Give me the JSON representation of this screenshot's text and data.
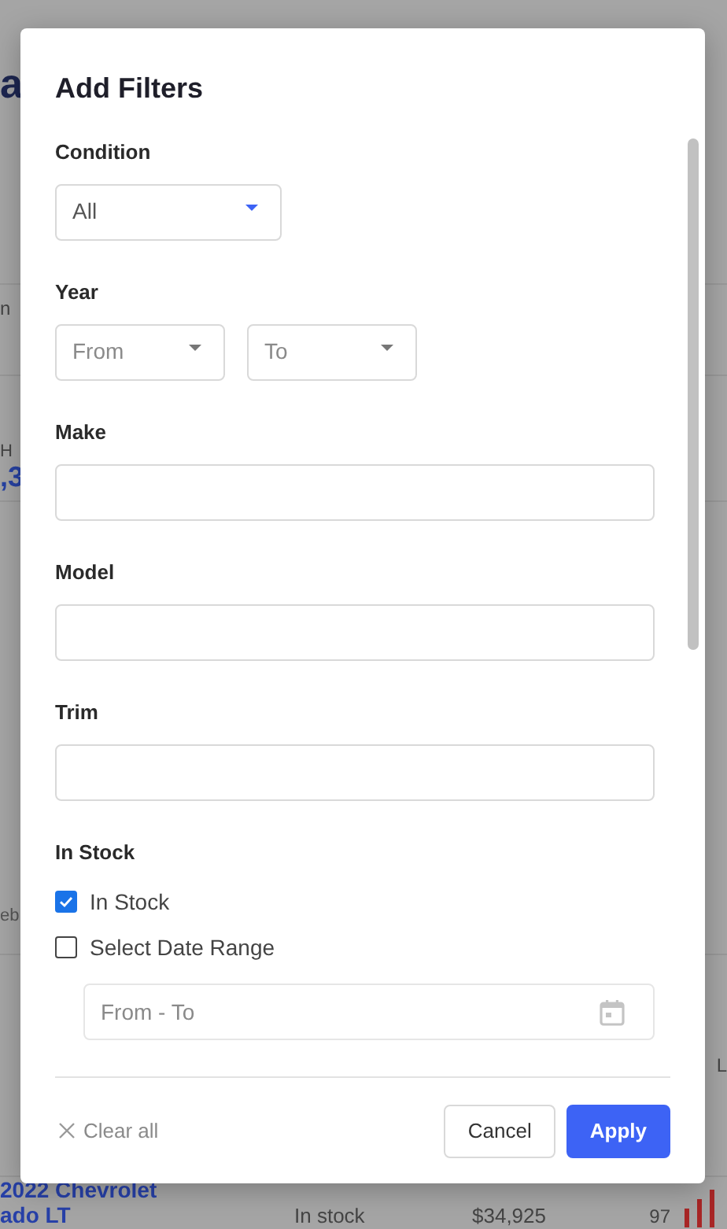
{
  "background": {
    "title_fragment": "a",
    "tab_fragment": "n",
    "stat_label_fragment": "H",
    "stat_value_fragment": ",3",
    "axis_fragment": "eb",
    "column_fragment": "L",
    "row": {
      "vehicle": [
        "2022 Chevrolet",
        "ado LT"
      ],
      "status": "In stock",
      "price": "$34,925",
      "score": "97"
    }
  },
  "dialog": {
    "title": "Add Filters",
    "sections": [
      {
        "kind": "select",
        "label": "Condition",
        "value": "All"
      },
      {
        "kind": "select-pair",
        "label": "Year",
        "placeholders": [
          "From",
          "To"
        ]
      },
      {
        "kind": "text",
        "label": "Make"
      },
      {
        "kind": "text",
        "label": "Model"
      },
      {
        "kind": "text",
        "label": "Trim"
      },
      {
        "kind": "checks",
        "label": "In Stock",
        "options": [
          {
            "label": "In Stock",
            "checked": true
          },
          {
            "label": "Select Date Range",
            "checked": false
          }
        ],
        "date_range": {
          "placeholder": "From - To"
        }
      }
    ],
    "clear": "Clear all",
    "buttons": [
      {
        "label": "Cancel",
        "kind": "secondary"
      },
      {
        "label": "Apply",
        "kind": "primary"
      }
    ]
  }
}
